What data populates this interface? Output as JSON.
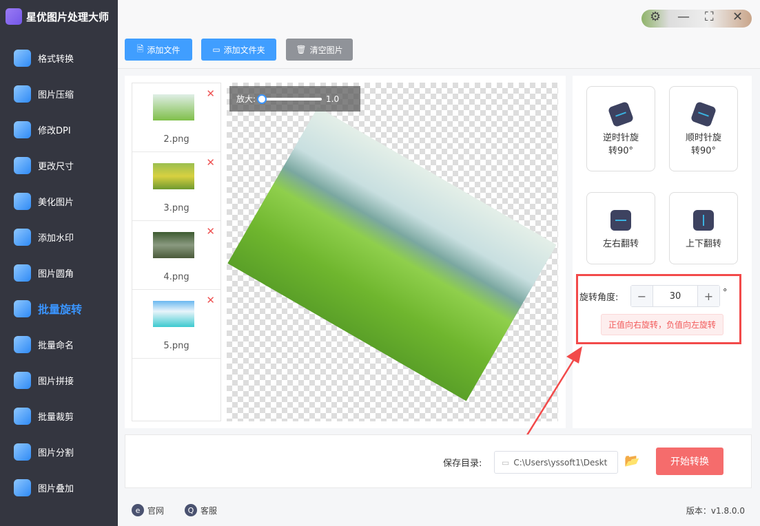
{
  "app": {
    "title": "星优图片处理大师"
  },
  "sidebar": {
    "items": [
      {
        "label": "格式转换"
      },
      {
        "label": "图片压缩"
      },
      {
        "label": "修改DPI"
      },
      {
        "label": "更改尺寸"
      },
      {
        "label": "美化图片"
      },
      {
        "label": "添加水印"
      },
      {
        "label": "图片圆角"
      },
      {
        "label": "批量旋转",
        "active": true
      },
      {
        "label": "批量命名"
      },
      {
        "label": "图片拼接"
      },
      {
        "label": "批量裁剪"
      },
      {
        "label": "图片分割"
      },
      {
        "label": "图片叠加"
      }
    ]
  },
  "toolbar": {
    "add_file": "添加文件",
    "add_folder": "添加文件夹",
    "clear": "清空图片"
  },
  "files": [
    {
      "name": "2.png"
    },
    {
      "name": "3.png"
    },
    {
      "name": "4.png"
    },
    {
      "name": "5.png"
    }
  ],
  "preview": {
    "zoom_label": "放大:",
    "zoom_value": "1.0",
    "rotation_deg": 30
  },
  "actions": {
    "ccw": "逆时针旋转90°",
    "cw": "顺时针旋转90°",
    "flip_h": "左右翻转",
    "flip_v": "上下翻转"
  },
  "angle": {
    "label": "旋转角度:",
    "value": "30",
    "unit": "°",
    "minus": "−",
    "plus": "+",
    "hint": "正值向右旋转，负值向左旋转"
  },
  "output": {
    "label": "保存目录:",
    "path": "C:\\Users\\yssoft1\\Deskt",
    "start": "开始转换"
  },
  "footer": {
    "website": "官网",
    "support": "客服",
    "version": "版本：v1.8.0.0"
  },
  "colors": {
    "primary": "#409eff",
    "danger": "#f56c6c",
    "sidebar": "#343640",
    "highlight": "#f24a4a"
  }
}
